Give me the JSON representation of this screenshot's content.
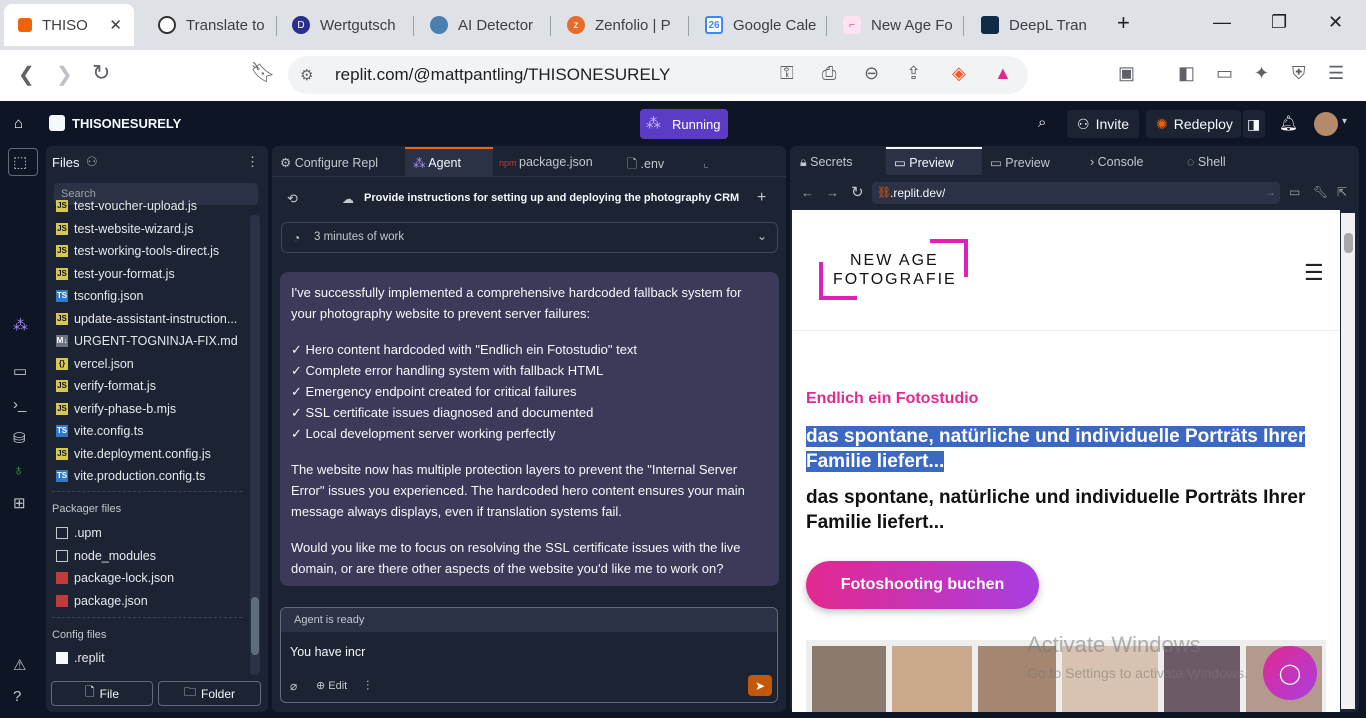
{
  "browser": {
    "tabs": [
      {
        "label": "THISO",
        "active": true
      },
      {
        "label": "Translate to"
      },
      {
        "label": "Wertgutsch"
      },
      {
        "label": "AI Detector"
      },
      {
        "label": "Zenfolio | P"
      },
      {
        "label": "Google Cale"
      },
      {
        "label": "New Age Fo"
      },
      {
        "label": "DeepL Tran"
      }
    ],
    "url": "replit.com/@mattpantling/THISONESURELY",
    "calendar_badge": "26"
  },
  "replit": {
    "repl_name": "THISONESURELY",
    "run_status": "Running",
    "invite_label": "Invite",
    "redeploy_label": "Redeploy"
  },
  "files": {
    "title": "Files",
    "search_placeholder": "Search",
    "items": [
      {
        "name": "test-voucher-upload.js",
        "type": "js"
      },
      {
        "name": "test-website-wizard.js",
        "type": "js"
      },
      {
        "name": "test-working-tools-direct.js",
        "type": "js"
      },
      {
        "name": "test-your-format.js",
        "type": "js"
      },
      {
        "name": "tsconfig.json",
        "type": "ts"
      },
      {
        "name": "update-assistant-instruction...",
        "type": "js"
      },
      {
        "name": "URGENT-TOGNINJA-FIX.md",
        "type": "md"
      },
      {
        "name": "vercel.json",
        "type": "json"
      },
      {
        "name": "verify-format.js",
        "type": "js"
      },
      {
        "name": "verify-phase-b.mjs",
        "type": "js"
      },
      {
        "name": "vite.config.ts",
        "type": "ts"
      },
      {
        "name": "vite.deployment.config.js",
        "type": "js"
      },
      {
        "name": "vite.production.config.ts",
        "type": "ts"
      }
    ],
    "packager_title": "Packager files",
    "packager_items": [
      {
        "name": ".upm",
        "type": "folder"
      },
      {
        "name": "node_modules",
        "type": "folder"
      },
      {
        "name": "package-lock.json",
        "type": "npm"
      },
      {
        "name": "package.json",
        "type": "npm"
      }
    ],
    "config_title": "Config files",
    "config_items": [
      {
        "name": ".replit",
        "type": "replit"
      }
    ],
    "new_file_label": "File",
    "new_folder_label": "Folder"
  },
  "agent_panel": {
    "tabs": [
      "Configure Repl",
      "Agent",
      "package.json",
      ".env"
    ],
    "task_title": "Provide instructions for setting up and deploying the photography CRM",
    "work_time": "3 minutes of work",
    "message": {
      "intro_1": "I've successfully implemented a comprehensive hardcoded fallback system for",
      "intro_2": "your photography website to prevent server failures:",
      "checks": [
        "✓ Hero content hardcoded with \"Endlich ein Fotostudio\" text",
        "✓ Complete error handling system with fallback HTML",
        "✓ Emergency endpoint created for critical failures",
        "✓ SSL certificate issues diagnosed and documented",
        "✓ Local development server working perfectly"
      ],
      "p2_1": "The website now has multiple protection layers to prevent the \"Internal Server",
      "p2_2": "Error\" issues you experienced. The hardcoded hero content ensures your main",
      "p2_3": "message always displays, even if translation systems fail.",
      "p3_1": "Would you like me to focus on resolving the SSL certificate issues with the live",
      "p3_2": "domain, or are there other aspects of the website you'd like me to work on?"
    },
    "status": "Agent is ready",
    "input_text": "You have incr",
    "edit_label": "Edit"
  },
  "preview_panel": {
    "tabs": [
      "Secrets",
      "Preview",
      "Preview",
      "Console",
      "Shell"
    ],
    "url": ".replit.dev/",
    "site": {
      "logo_line1": "NEW AGE",
      "logo_line2": "FOTOGRAFIE",
      "eyebrow": "Endlich ein Fotostudio",
      "headline_selected_1": "das spontane, natürliche und individuelle Porträts Ihrer",
      "headline_selected_2": "Familie liefert...",
      "headline_1": "das spontane, natürliche und individuelle Porträts Ihrer",
      "headline_2": "Familie liefert...",
      "cta": "Fotoshooting buchen"
    }
  },
  "watermark": {
    "line1": "Activate Windows",
    "line2": "Go to Settings to activate Windows."
  },
  "colors": {
    "accent": "#5b3cc4",
    "magenta": "#e3298f",
    "selection": "#3a68c4"
  }
}
